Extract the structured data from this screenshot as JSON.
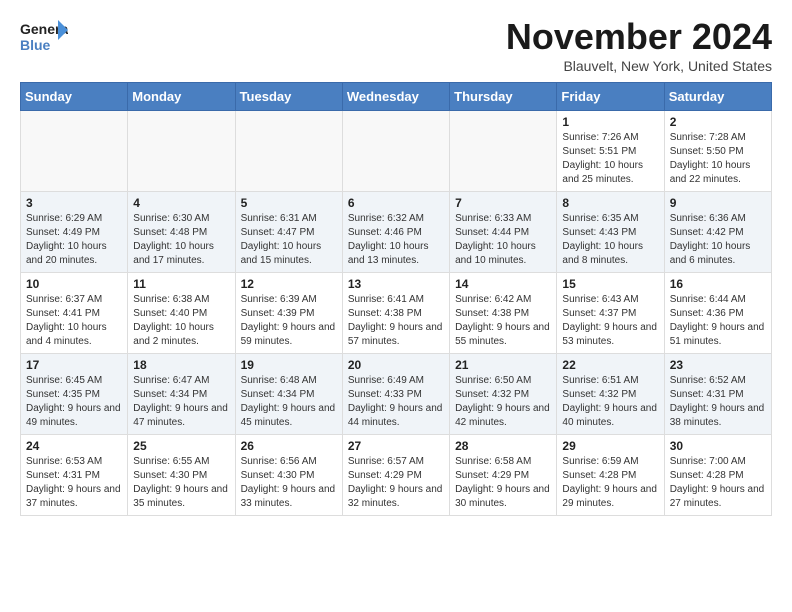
{
  "logo": {
    "line1": "General",
    "line2": "Blue"
  },
  "title": "November 2024",
  "location": "Blauvelt, New York, United States",
  "weekdays": [
    "Sunday",
    "Monday",
    "Tuesday",
    "Wednesday",
    "Thursday",
    "Friday",
    "Saturday"
  ],
  "weeks": [
    [
      {
        "day": "",
        "info": ""
      },
      {
        "day": "",
        "info": ""
      },
      {
        "day": "",
        "info": ""
      },
      {
        "day": "",
        "info": ""
      },
      {
        "day": "",
        "info": ""
      },
      {
        "day": "1",
        "info": "Sunrise: 7:26 AM\nSunset: 5:51 PM\nDaylight: 10 hours and 25 minutes."
      },
      {
        "day": "2",
        "info": "Sunrise: 7:28 AM\nSunset: 5:50 PM\nDaylight: 10 hours and 22 minutes."
      }
    ],
    [
      {
        "day": "3",
        "info": "Sunrise: 6:29 AM\nSunset: 4:49 PM\nDaylight: 10 hours and 20 minutes."
      },
      {
        "day": "4",
        "info": "Sunrise: 6:30 AM\nSunset: 4:48 PM\nDaylight: 10 hours and 17 minutes."
      },
      {
        "day": "5",
        "info": "Sunrise: 6:31 AM\nSunset: 4:47 PM\nDaylight: 10 hours and 15 minutes."
      },
      {
        "day": "6",
        "info": "Sunrise: 6:32 AM\nSunset: 4:46 PM\nDaylight: 10 hours and 13 minutes."
      },
      {
        "day": "7",
        "info": "Sunrise: 6:33 AM\nSunset: 4:44 PM\nDaylight: 10 hours and 10 minutes."
      },
      {
        "day": "8",
        "info": "Sunrise: 6:35 AM\nSunset: 4:43 PM\nDaylight: 10 hours and 8 minutes."
      },
      {
        "day": "9",
        "info": "Sunrise: 6:36 AM\nSunset: 4:42 PM\nDaylight: 10 hours and 6 minutes."
      }
    ],
    [
      {
        "day": "10",
        "info": "Sunrise: 6:37 AM\nSunset: 4:41 PM\nDaylight: 10 hours and 4 minutes."
      },
      {
        "day": "11",
        "info": "Sunrise: 6:38 AM\nSunset: 4:40 PM\nDaylight: 10 hours and 2 minutes."
      },
      {
        "day": "12",
        "info": "Sunrise: 6:39 AM\nSunset: 4:39 PM\nDaylight: 9 hours and 59 minutes."
      },
      {
        "day": "13",
        "info": "Sunrise: 6:41 AM\nSunset: 4:38 PM\nDaylight: 9 hours and 57 minutes."
      },
      {
        "day": "14",
        "info": "Sunrise: 6:42 AM\nSunset: 4:38 PM\nDaylight: 9 hours and 55 minutes."
      },
      {
        "day": "15",
        "info": "Sunrise: 6:43 AM\nSunset: 4:37 PM\nDaylight: 9 hours and 53 minutes."
      },
      {
        "day": "16",
        "info": "Sunrise: 6:44 AM\nSunset: 4:36 PM\nDaylight: 9 hours and 51 minutes."
      }
    ],
    [
      {
        "day": "17",
        "info": "Sunrise: 6:45 AM\nSunset: 4:35 PM\nDaylight: 9 hours and 49 minutes."
      },
      {
        "day": "18",
        "info": "Sunrise: 6:47 AM\nSunset: 4:34 PM\nDaylight: 9 hours and 47 minutes."
      },
      {
        "day": "19",
        "info": "Sunrise: 6:48 AM\nSunset: 4:34 PM\nDaylight: 9 hours and 45 minutes."
      },
      {
        "day": "20",
        "info": "Sunrise: 6:49 AM\nSunset: 4:33 PM\nDaylight: 9 hours and 44 minutes."
      },
      {
        "day": "21",
        "info": "Sunrise: 6:50 AM\nSunset: 4:32 PM\nDaylight: 9 hours and 42 minutes."
      },
      {
        "day": "22",
        "info": "Sunrise: 6:51 AM\nSunset: 4:32 PM\nDaylight: 9 hours and 40 minutes."
      },
      {
        "day": "23",
        "info": "Sunrise: 6:52 AM\nSunset: 4:31 PM\nDaylight: 9 hours and 38 minutes."
      }
    ],
    [
      {
        "day": "24",
        "info": "Sunrise: 6:53 AM\nSunset: 4:31 PM\nDaylight: 9 hours and 37 minutes."
      },
      {
        "day": "25",
        "info": "Sunrise: 6:55 AM\nSunset: 4:30 PM\nDaylight: 9 hours and 35 minutes."
      },
      {
        "day": "26",
        "info": "Sunrise: 6:56 AM\nSunset: 4:30 PM\nDaylight: 9 hours and 33 minutes."
      },
      {
        "day": "27",
        "info": "Sunrise: 6:57 AM\nSunset: 4:29 PM\nDaylight: 9 hours and 32 minutes."
      },
      {
        "day": "28",
        "info": "Sunrise: 6:58 AM\nSunset: 4:29 PM\nDaylight: 9 hours and 30 minutes."
      },
      {
        "day": "29",
        "info": "Sunrise: 6:59 AM\nSunset: 4:28 PM\nDaylight: 9 hours and 29 minutes."
      },
      {
        "day": "30",
        "info": "Sunrise: 7:00 AM\nSunset: 4:28 PM\nDaylight: 9 hours and 27 minutes."
      }
    ]
  ]
}
